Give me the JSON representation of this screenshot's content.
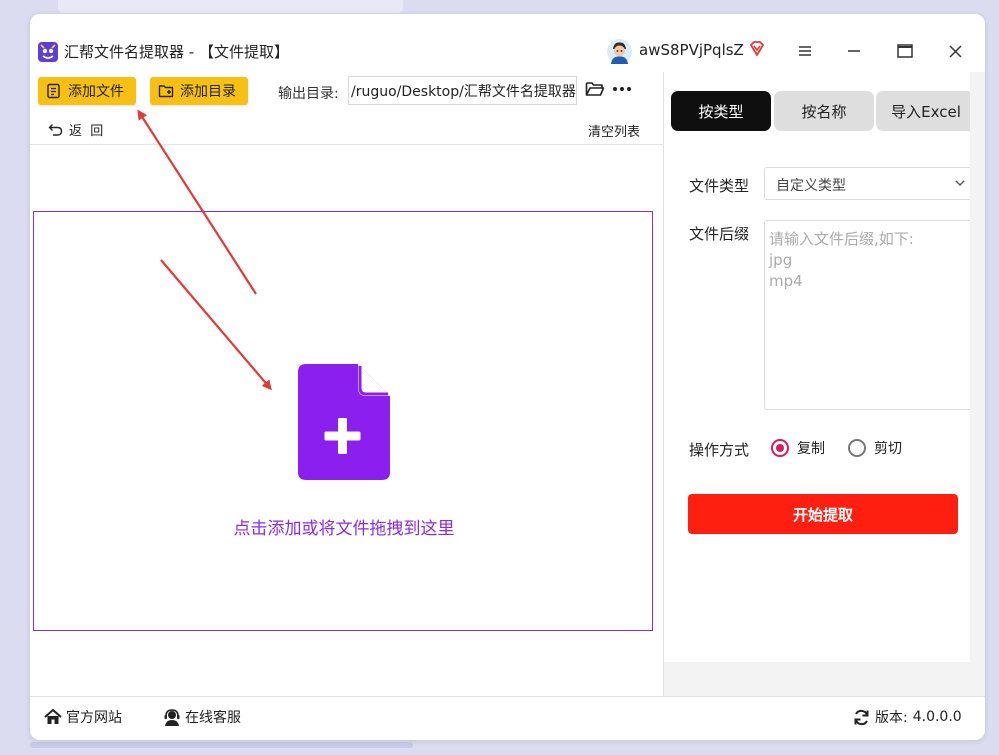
{
  "window": {
    "title": "汇帮文件名提取器 - 【文件提取】",
    "user_name": "awS8PVjPqlsZ"
  },
  "toolbar": {
    "add_file_label": "添加文件",
    "add_folder_label": "添加目录",
    "output_label": "输出目录:",
    "output_path": "/ruguo/Desktop/汇帮文件名提取器",
    "back_label": "返  回",
    "clear_label": "清空列表"
  },
  "dropzone": {
    "text": "点击添加或将文件拖拽到这里"
  },
  "right_panel": {
    "tabs": [
      {
        "label": "按类型",
        "active": true
      },
      {
        "label": "按名称",
        "active": false
      },
      {
        "label": "导入Excel",
        "active": false
      }
    ],
    "file_type_label": "文件类型",
    "file_type_value": "自定义类型",
    "suffix_label": "文件后缀",
    "suffix_placeholder": "请输入文件后缀,如下:\njpg\nmp4",
    "operation_label": "操作方式",
    "operation_options": [
      {
        "label": "复制",
        "selected": true
      },
      {
        "label": "剪切",
        "selected": false
      }
    ],
    "start_label": "开始提取"
  },
  "footer": {
    "website_label": "官方网站",
    "service_label": "在线客服",
    "version_label": "版本:",
    "version_value": "4.0.0.0"
  },
  "colors": {
    "accent_yellow": "#f8c013",
    "accent_purple": "#8a2be2",
    "start_red": "#ff1f10",
    "tab_active": "#0f0f0f",
    "radio_selected": "#d81b60",
    "arrow_red": "#e53935"
  },
  "icons": {
    "app": "app-logo-icon",
    "avatar": "user-avatar-icon",
    "vip": "vip-diamond-icon",
    "menu": "hamburger-menu-icon",
    "minimize": "minimize-icon",
    "maximize": "maximize-icon",
    "close": "close-icon",
    "add_file": "add-file-icon",
    "add_folder": "add-folder-icon",
    "folder_browse": "folder-open-icon",
    "more": "more-dots-icon",
    "back": "back-arrow-icon",
    "file_plus": "file-plus-icon",
    "home": "home-icon",
    "service": "customer-service-icon",
    "refresh": "refresh-icon"
  }
}
